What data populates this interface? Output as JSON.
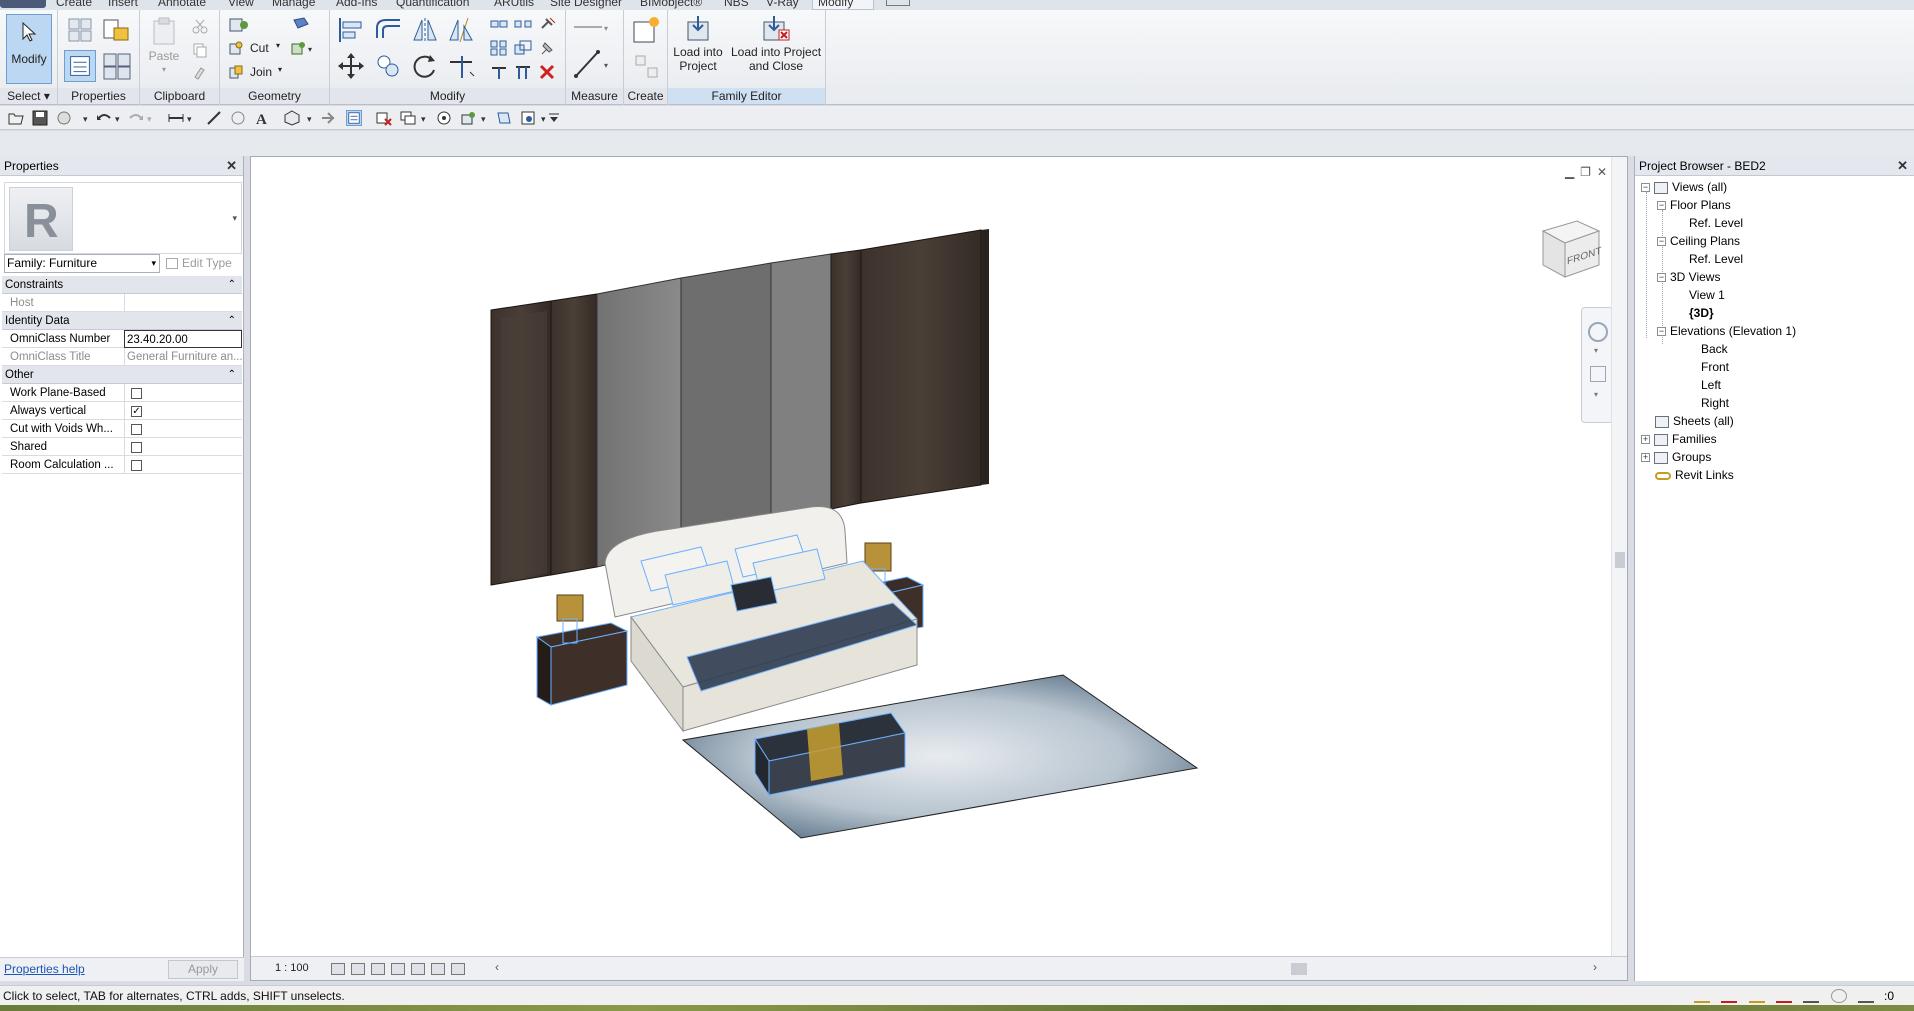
{
  "ribbon_tabs": [
    "Create",
    "Insert",
    "Annotate",
    "View",
    "Manage",
    "Add-Ins",
    "Quantification",
    "ARUtils",
    "Site Designer",
    "BIMobject®",
    "NBS",
    "V-Ray",
    "Modify"
  ],
  "ribbon": {
    "select_panel": {
      "modify_label": "Modify",
      "panel_label": "Select"
    },
    "properties_panel": {
      "panel_label": "Properties"
    },
    "clipboard_panel": {
      "paste_label": "Paste",
      "panel_label": "Clipboard"
    },
    "geometry_panel": {
      "cut_label": "Cut",
      "join_label": "Join",
      "panel_label": "Geometry"
    },
    "modify_panel": {
      "panel_label": "Modify"
    },
    "measure_panel": {
      "panel_label": "Measure"
    },
    "create_panel": {
      "panel_label": "Create"
    },
    "family_editor_panel": {
      "load_into_project": "Load into Project",
      "load_into_project_close": "Load into Project and Close",
      "panel_label": "Family Editor"
    }
  },
  "properties": {
    "title": "Properties",
    "family_select": "Family: Furniture",
    "edit_type": "Edit Type",
    "categories": {
      "constraints": "Constraints",
      "identity": "Identity Data",
      "other": "Other"
    },
    "rows": {
      "host": {
        "key": "Host",
        "value": ""
      },
      "omniclass_number": {
        "key": "OmniClass Number",
        "value": "23.40.20.00"
      },
      "omniclass_title": {
        "key": "OmniClass Title",
        "value": "General Furniture an..."
      },
      "work_plane_based": {
        "key": "Work Plane-Based",
        "checked": false
      },
      "always_vertical": {
        "key": "Always vertical",
        "checked": true
      },
      "cut_with_voids": {
        "key": "Cut with Voids Wh...",
        "checked": false
      },
      "shared": {
        "key": "Shared",
        "checked": false
      },
      "room_calc": {
        "key": "Room Calculation ...",
        "checked": false
      }
    },
    "help_link": "Properties help",
    "apply_label": "Apply"
  },
  "view": {
    "scale": "1 : 100",
    "viewcube_face": "FRONT"
  },
  "project_browser": {
    "title": "Project Browser - BED2",
    "items": [
      {
        "label": "Views (all)"
      },
      {
        "label": "Floor Plans"
      },
      {
        "label": "Ref. Level"
      },
      {
        "label": "Ceiling Plans"
      },
      {
        "label": "Ref. Level"
      },
      {
        "label": "3D Views"
      },
      {
        "label": "View 1"
      },
      {
        "label": "{3D}"
      },
      {
        "label": "Elevations (Elevation 1)"
      },
      {
        "label": "Back"
      },
      {
        "label": "Front"
      },
      {
        "label": "Left"
      },
      {
        "label": "Right"
      },
      {
        "label": "Sheets (all)"
      },
      {
        "label": "Families"
      },
      {
        "label": "Groups"
      },
      {
        "label": "Revit Links"
      }
    ]
  },
  "status_bar": {
    "text": "Click to select, TAB for alternates, CTRL adds, SHIFT unselects.",
    "filter_count": ":0"
  },
  "colors": {
    "ribbon_bg": "#eef0f3",
    "active_blue": "#bcd7f2",
    "wall_wood": "#3a302a",
    "bed_linen": "#ecebe6",
    "lamp_gold": "#b8923a"
  }
}
